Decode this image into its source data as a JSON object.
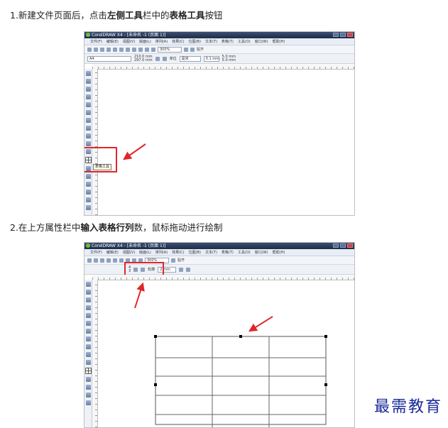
{
  "steps": [
    {
      "prefix": "1.新建文件页面后，点击",
      "bold1": "左侧工具",
      "middle": "栏中的",
      "bold2": "表格工具",
      "suffix": "按钮"
    },
    {
      "prefix": "2.在上方属性栏中",
      "bold1": "输入表格行列",
      "suffix": "数，鼠标拖动进行绘制"
    }
  ],
  "app": {
    "title1": "CorelDRAW X4 - [未命名 -1 (页面 1)]",
    "title2": "CorelDRAW X4 - [未命名 -1 (页面 1)]",
    "menu": [
      "文件(F)",
      "编辑(E)",
      "视图(V)",
      "版面(L)",
      "排列(A)",
      "效果(C)",
      "位图(B)",
      "文本(T)",
      "表格(T)",
      "工具(O)",
      "窗口(W)",
      "帮助(H)"
    ],
    "zoom": "300%",
    "paper_size": "A4",
    "width_value": "210.0 mm",
    "height_value": "297.0 mm",
    "unit_label": "单位",
    "unit_value": "毫米",
    "nudge_value": "0.1 mm",
    "dup_x": "5.0 mm",
    "dup_y": "5.0 mm",
    "snap_label": "贴齐",
    "table_rows": "4",
    "table_cols": "3",
    "outline_label": "轮廓",
    "outline_value": "2 mm",
    "table_tool_tooltip": "表格工具"
  },
  "watermark": "最需教育",
  "colors": {
    "highlight": "#e0262b",
    "watermark": "#1a2a9a",
    "titlebar": "#2a3a5c"
  }
}
